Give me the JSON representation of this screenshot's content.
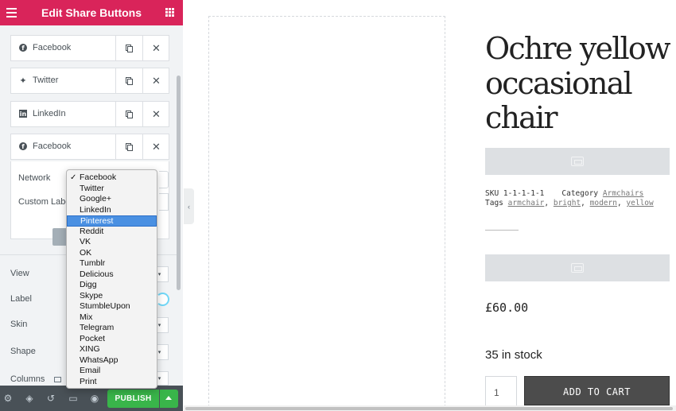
{
  "editor": {
    "header_title": "Edit Share Buttons",
    "items": [
      {
        "label": "Facebook",
        "icon": "facebook-icon"
      },
      {
        "label": "Twitter",
        "icon": "twitter-icon"
      },
      {
        "label": "LinkedIn",
        "icon": "linkedin-icon"
      },
      {
        "label": "Facebook",
        "icon": "facebook-icon"
      }
    ],
    "opened_item": {
      "network_label": "Network",
      "custom_label_label": "Custom Label"
    },
    "controls": {
      "view": "View",
      "label": "Label",
      "skin": "Skin",
      "shape": "Shape",
      "columns": "Columns"
    },
    "footer": {
      "publish_label": "PUBLISH"
    }
  },
  "network_dropdown": {
    "selected": "Facebook",
    "highlighted": "Pinterest",
    "options": [
      "Facebook",
      "Twitter",
      "Google+",
      "LinkedIn",
      "Pinterest",
      "Reddit",
      "VK",
      "OK",
      "Tumblr",
      "Delicious",
      "Digg",
      "Skype",
      "StumbleUpon",
      "Mix",
      "Telegram",
      "Pocket",
      "XING",
      "WhatsApp",
      "Email",
      "Print"
    ]
  },
  "product": {
    "title_lines": [
      "Ochre yellow",
      "occasional",
      "chair"
    ],
    "sku_label": "SKU",
    "sku_value": "1-1-1-1-1",
    "category_label": "Category",
    "category_value": "Armchairs",
    "tags_label": "Tags",
    "tags": [
      "armchair",
      "bright",
      "modern",
      "yellow"
    ],
    "price": "£60.00",
    "stock": "35 in stock",
    "quantity": "1",
    "add_to_cart": "ADD TO CART"
  },
  "colors": {
    "header": "#d9245a",
    "publish": "#39b54a",
    "highlight": "#4a90e2"
  }
}
